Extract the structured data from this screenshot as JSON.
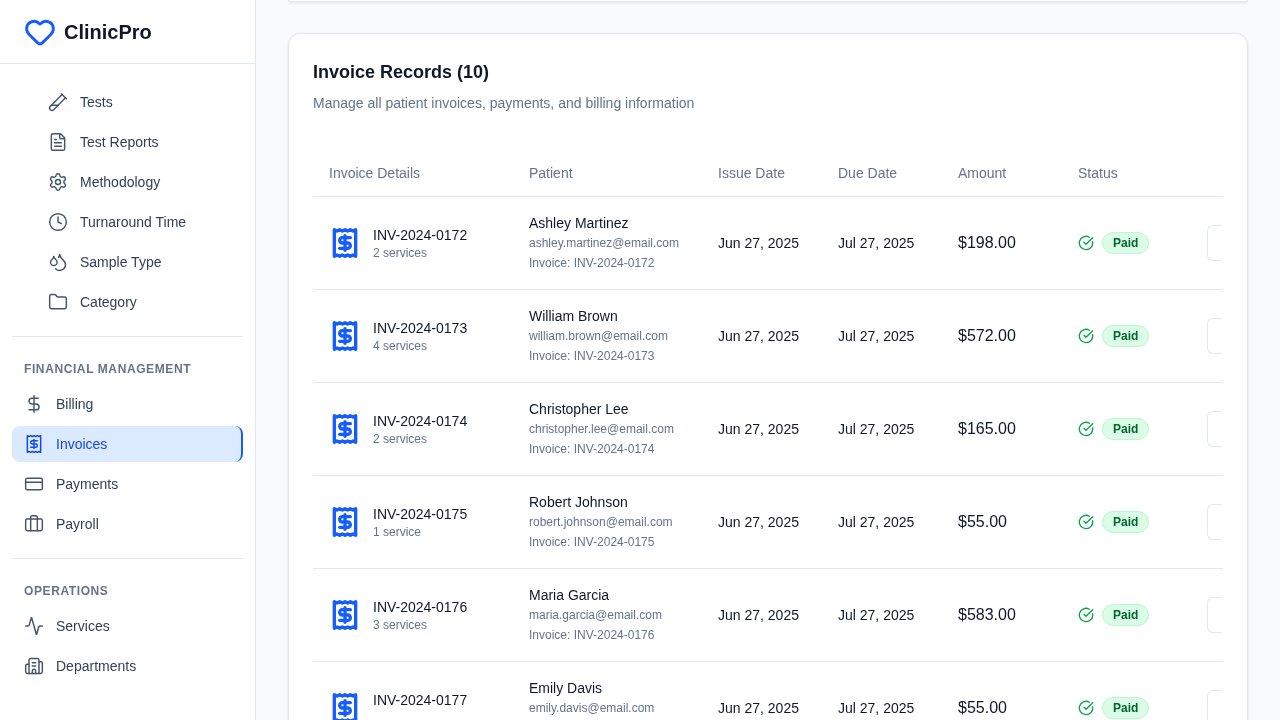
{
  "brand": {
    "name": "ClinicPro"
  },
  "sidebar": {
    "submenu": [
      {
        "label": "Tests",
        "selected": false
      },
      {
        "label": "Test Reports",
        "selected": false
      },
      {
        "label": "Methodology",
        "selected": false
      },
      {
        "label": "Turnaround Time",
        "selected": false
      },
      {
        "label": "Sample Type",
        "selected": false
      },
      {
        "label": "Category",
        "selected": false
      }
    ],
    "sections": [
      {
        "heading": "FINANCIAL MANAGEMENT",
        "items": [
          {
            "label": "Billing",
            "selected": false
          },
          {
            "label": "Invoices",
            "selected": true
          },
          {
            "label": "Payments",
            "selected": false
          },
          {
            "label": "Payroll",
            "selected": false
          }
        ]
      },
      {
        "heading": "OPERATIONS",
        "items": [
          {
            "label": "Services",
            "selected": false
          },
          {
            "label": "Departments",
            "selected": false
          }
        ]
      }
    ]
  },
  "invoices": {
    "title": "Invoice Records (10)",
    "subtitle": "Manage all patient invoices, payments, and billing information",
    "columns": [
      "Invoice Details",
      "Patient",
      "Issue Date",
      "Due Date",
      "Amount",
      "Status"
    ],
    "rows": [
      {
        "invoice": "INV-2024-0172",
        "services": "2 services",
        "patient": "Ashley Martinez",
        "email": "ashley.martinez@email.com",
        "reference": "Invoice: INV-2024-0172",
        "issue_date": "Jun 27, 2025",
        "due_date": "Jul 27, 2025",
        "amount": "$198.00",
        "status": "Paid"
      },
      {
        "invoice": "INV-2024-0173",
        "services": "4 services",
        "patient": "William Brown",
        "email": "william.brown@email.com",
        "reference": "Invoice: INV-2024-0173",
        "issue_date": "Jun 27, 2025",
        "due_date": "Jul 27, 2025",
        "amount": "$572.00",
        "status": "Paid"
      },
      {
        "invoice": "INV-2024-0174",
        "services": "2 services",
        "patient": "Christopher Lee",
        "email": "christopher.lee@email.com",
        "reference": "Invoice: INV-2024-0174",
        "issue_date": "Jun 27, 2025",
        "due_date": "Jul 27, 2025",
        "amount": "$165.00",
        "status": "Paid"
      },
      {
        "invoice": "INV-2024-0175",
        "services": "1 service",
        "patient": "Robert Johnson",
        "email": "robert.johnson@email.com",
        "reference": "Invoice: INV-2024-0175",
        "issue_date": "Jun 27, 2025",
        "due_date": "Jul 27, 2025",
        "amount": "$55.00",
        "status": "Paid"
      },
      {
        "invoice": "INV-2024-0176",
        "services": "3 services",
        "patient": "Maria Garcia",
        "email": "maria.garcia@email.com",
        "reference": "Invoice: INV-2024-0176",
        "issue_date": "Jun 27, 2025",
        "due_date": "Jul 27, 2025",
        "amount": "$583.00",
        "status": "Paid"
      },
      {
        "invoice": "INV-2024-0177",
        "patient": "Emily Davis",
        "email": "emily.davis@email.com",
        "issue_date": "Jun 27, 2025",
        "due_date": "Jul 27, 2025",
        "amount": "$55.00",
        "status": "Paid"
      }
    ]
  }
}
